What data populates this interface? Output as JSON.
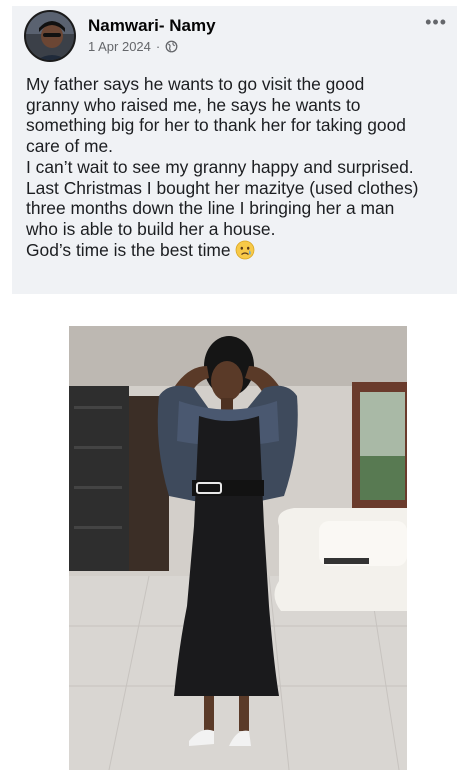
{
  "post": {
    "author": "Namwari- Namy",
    "date": "1 Apr 2024",
    "separator": "·",
    "privacy_icon": "globe-icon",
    "more_icon": "more-options-icon",
    "lines": [
      "My father says he wants to go visit the good",
      "granny who raised me, he says he wants to",
      "something big for her to thank her for taking good",
      "care of me.",
      "I can’t wait to see my granny happy and surprised.",
      "Last Christmas I bought her mazitye (used clothes)",
      "three months down the line I bringing her a man",
      "who is able to build her a house.",
      "God’s time is the best time"
    ],
    "emoji": "crying-face"
  },
  "colors": {
    "card_bg": "#f0f2f5",
    "meta_text": "#65676b",
    "text": "#1c1e21"
  }
}
